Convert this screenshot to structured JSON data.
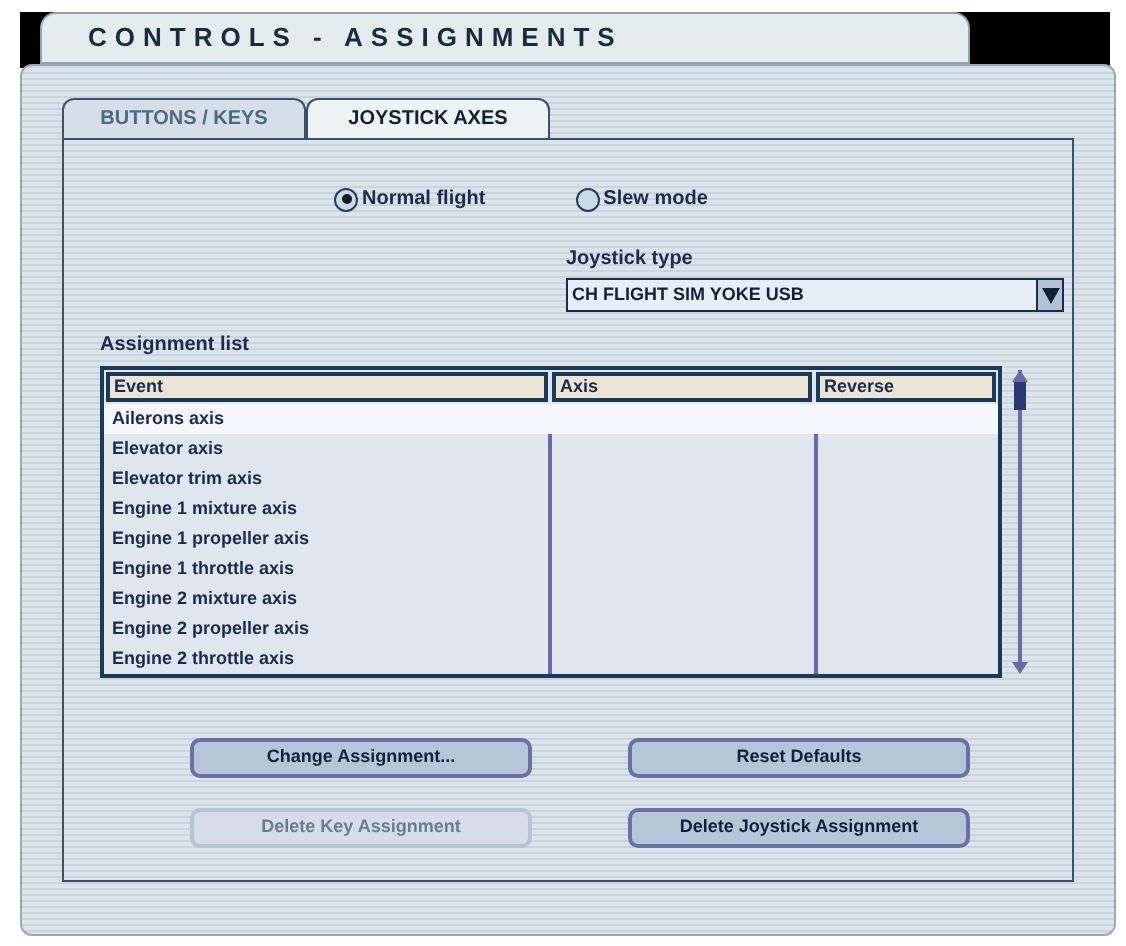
{
  "window": {
    "title": "CONTROLS - ASSIGNMENTS"
  },
  "tabs": [
    {
      "label": "BUTTONS / KEYS",
      "selected": false
    },
    {
      "label": "JOYSTICK AXES",
      "selected": true
    }
  ],
  "modes": [
    {
      "label": "Normal flight",
      "selected": true
    },
    {
      "label": "Slew mode",
      "selected": false
    }
  ],
  "joystick_type": {
    "label": "Joystick type",
    "value": "CH FLIGHT SIM YOKE USB"
  },
  "assignment_list": {
    "label": "Assignment list",
    "columns": [
      "Event",
      "Axis",
      "Reverse"
    ],
    "rows": [
      {
        "event": "Ailerons axis",
        "selected": true
      },
      {
        "event": "Elevator axis",
        "selected": false
      },
      {
        "event": "Elevator trim axis",
        "selected": false
      },
      {
        "event": "Engine 1 mixture axis",
        "selected": false
      },
      {
        "event": "Engine 1 propeller axis",
        "selected": false
      },
      {
        "event": "Engine 1 throttle axis",
        "selected": false
      },
      {
        "event": "Engine 2 mixture axis",
        "selected": false
      },
      {
        "event": "Engine 2 propeller axis",
        "selected": false
      },
      {
        "event": "Engine 2 throttle axis",
        "selected": false
      }
    ]
  },
  "buttons": [
    {
      "label": "Change Assignment...",
      "disabled": false
    },
    {
      "label": "Reset Defaults",
      "disabled": false
    },
    {
      "label": "Delete Key Assignment",
      "disabled": true
    },
    {
      "label": "Delete Joystick Assignment",
      "disabled": false
    }
  ]
}
